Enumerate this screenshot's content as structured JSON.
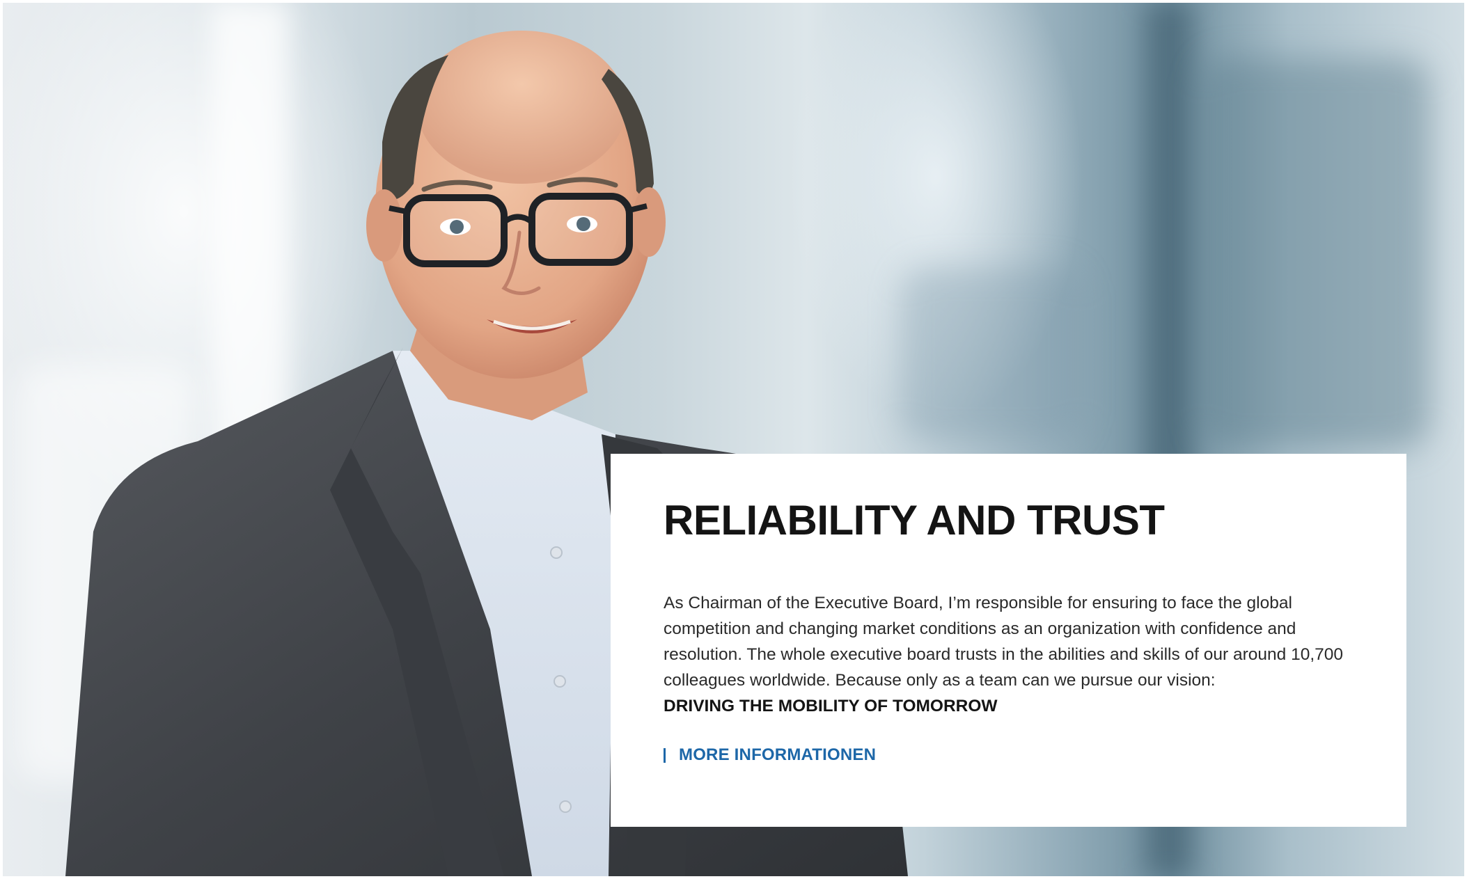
{
  "hero": {
    "title": "RELIABILITY AND TRUST",
    "body": "As Chairman of the Executive Board, I’m responsible for ensuring to face the global competition and changing market conditions as an organization with confidence and resolution. The whole executive board trusts in the abilities and skills of our around 10,700 colleagues worldwide. Because only as a team can we pursue our vision:",
    "tagline": "DRIVING THE MOBILITY OF TOMORROW",
    "link_label": "MORE INFORMATIONEN",
    "link_accent_color": "#1d67a8"
  },
  "icons": {
    "link_marker": "vertical-bar-icon"
  }
}
